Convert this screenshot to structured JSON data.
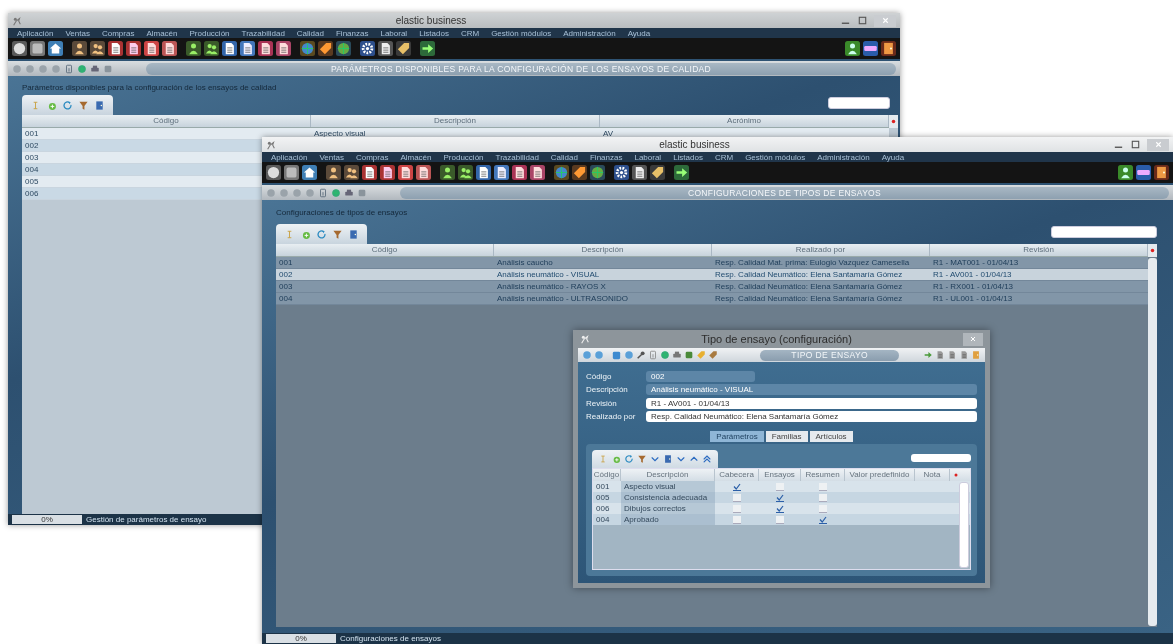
{
  "back_window": {
    "title": "elastic business",
    "menu": [
      "Aplicación",
      "Ventas",
      "Compras",
      "Almacén",
      "Producción",
      "Trazabilidad",
      "Calidad",
      "Finanzas",
      "Laboral",
      "Listados",
      "CRM",
      "Gestión módulos",
      "Administración",
      "Ayuda"
    ],
    "header_title": "PARÁMETROS DISPONIBLES PARA LA CONFIGURACIÓN DE LOS ENSAYOS DE CALIDAD",
    "subtitle": "Parámetros disponibles para la configuración de los ensayos de calidad",
    "table": {
      "columns": [
        "Código",
        "Descripción",
        "Acrónimo"
      ],
      "rows": [
        {
          "cells": [
            "001",
            "Aspecto visual",
            "AV"
          ]
        },
        {
          "cells": [
            "002"
          ]
        },
        {
          "cells": [
            "003"
          ]
        },
        {
          "cells": [
            "004"
          ]
        },
        {
          "cells": [
            "005"
          ]
        },
        {
          "cells": [
            "006"
          ]
        }
      ]
    },
    "status_bar": {
      "progress": "0%",
      "message": "Gestión de parámetros de ensayo"
    }
  },
  "front_window": {
    "title": "elastic business",
    "menu": [
      "Aplicación",
      "Ventas",
      "Compras",
      "Almacén",
      "Producción",
      "Trazabilidad",
      "Calidad",
      "Finanzas",
      "Laboral",
      "Listados",
      "CRM",
      "Gestión módulos",
      "Administración",
      "Ayuda"
    ],
    "header_title": "CONFIGURACIONES DE TIPOS DE ENSAYOS",
    "subtitle": "Configuraciones de tipos de ensayos",
    "table": {
      "columns": [
        "Código",
        "Descripción",
        "Realizado por",
        "Revisión"
      ],
      "rows": [
        {
          "cells": [
            "001",
            "Análisis caucho",
            "Resp. Calidad Mat. prima: Eulogio Vazquez Camesella",
            "R1 - MAT001 - 01/04/13"
          ],
          "selected": false
        },
        {
          "cells": [
            "002",
            "Análisis neumático - VISUAL",
            "Resp. Calidad Neumático: Elena Santamaría Gómez",
            "R1 - AV001 - 01/04/13"
          ],
          "selected": true
        },
        {
          "cells": [
            "003",
            "Análisis neumático - RAYOS X",
            "Resp. Calidad Neumático: Elena Santamaría Gómez",
            "R1 - RX001 - 01/04/13"
          ],
          "selected": false
        },
        {
          "cells": [
            "004",
            "Análisis neumático - ULTRASONIDO",
            "Resp. Calidad Neumático: Elena Santamaría Gómez",
            "R1 - UL001 - 01/04/13"
          ],
          "selected": false
        }
      ]
    },
    "status_bar": {
      "progress": "0%",
      "message": "Configuraciones de ensayos"
    }
  },
  "dialog": {
    "title": "Tipo de ensayo (configuración)",
    "header_title": "TIPO DE ENSAYO",
    "fields": [
      {
        "label": "Código",
        "value": "002",
        "readonly": true,
        "kind": "short"
      },
      {
        "label": "Descripción",
        "value": "Análisis neumático - VISUAL",
        "readonly": true,
        "kind": "wide"
      },
      {
        "label": "Revisión",
        "value": "R1 - AV001 - 01/04/13",
        "readonly": false,
        "kind": "wide"
      },
      {
        "label": "Realizado por",
        "value": "Resp. Calidad Neumático: Elena Santamaría Gómez",
        "readonly": false,
        "kind": "wide"
      }
    ],
    "tabs": [
      {
        "label": "Parámetros",
        "selected": true
      },
      {
        "label": "Familias",
        "selected": false
      },
      {
        "label": "Artículos",
        "selected": false
      }
    ],
    "table": {
      "columns": [
        "Código",
        "Descripción",
        "Cabecera",
        "Ensayos",
        "Resumen",
        "Valor predefinido",
        "Nota"
      ],
      "rows": [
        {
          "cells": [
            "001",
            "Aspecto visual"
          ],
          "checks": [
            true,
            false,
            false
          ]
        },
        {
          "cells": [
            "005",
            "Consistencia adecuada"
          ],
          "checks": [
            false,
            true,
            false
          ]
        },
        {
          "cells": [
            "006",
            "Dibujos correctos"
          ],
          "checks": [
            false,
            true,
            false
          ]
        },
        {
          "cells": [
            "004",
            "Aprobado"
          ],
          "checks": [
            false,
            false,
            true
          ]
        }
      ]
    }
  }
}
